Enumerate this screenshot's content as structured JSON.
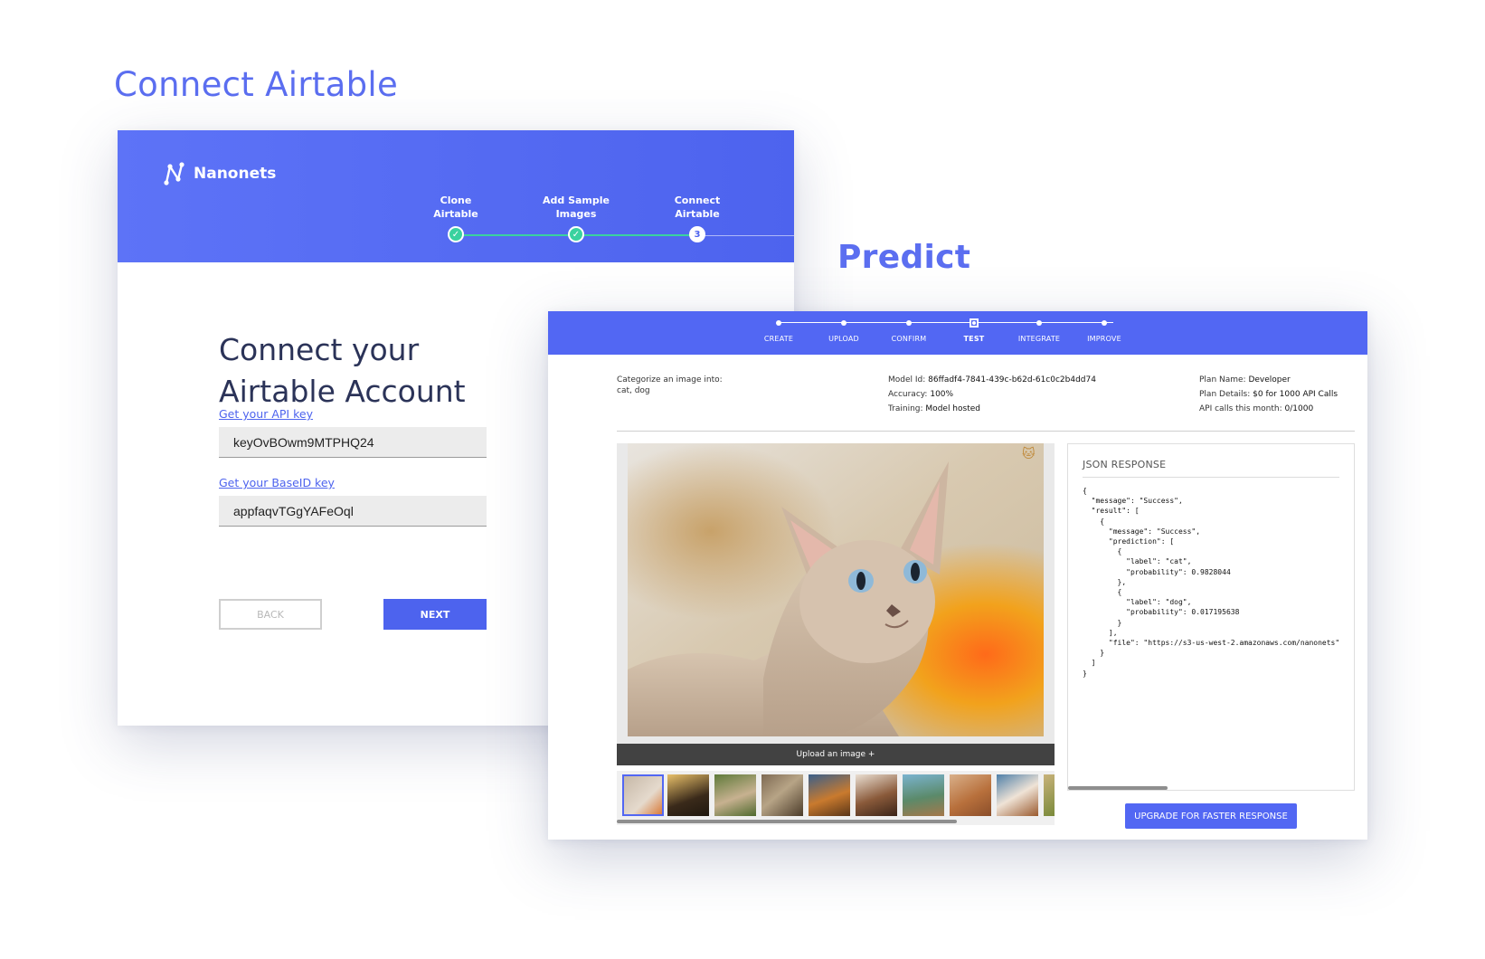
{
  "headings": {
    "connect": "Connect Airtable",
    "predict": "Predict"
  },
  "connect": {
    "brand": "Nanonets",
    "steps": [
      {
        "line1": "Clone",
        "line2": "Airtable",
        "state": "done"
      },
      {
        "line1": "Add Sample",
        "line2": "Images",
        "state": "done"
      },
      {
        "line1": "Connect",
        "line2": "Airtable",
        "state": "current",
        "number": "3"
      }
    ],
    "title_line1": "Connect your",
    "title_line2": "Airtable Account",
    "api_link": "Get your API key",
    "api_value": "keyOvBOwm9MTPHQ24",
    "base_link": "Get your BaseID key",
    "base_value": "appfaqvTGgYAFeOql",
    "back_label": "BACK",
    "next_label": "NEXT",
    "colors": {
      "header": "#4d63ee",
      "done": "#3ad29f",
      "title": "#2b3358"
    }
  },
  "predict": {
    "steps": [
      "CREATE",
      "UPLOAD",
      "CONFIRM",
      "TEST",
      "INTEGRATE",
      "IMPROVE"
    ],
    "current_step": "TEST",
    "categorize_label": "Categorize an image into:",
    "categories": "cat, dog",
    "model_id_label": "Model Id:",
    "model_id": "86ffadf4-7841-439c-b62d-61c0c2b4dd74",
    "accuracy_label": "Accuracy:",
    "accuracy": "100%",
    "training_label": "Training:",
    "training": "Model hosted",
    "plan_name_label": "Plan Name:",
    "plan_name": "Developer",
    "plan_details_label": "Plan Details:",
    "plan_details": "$0 for 1000 API Calls",
    "api_calls_label": "API calls this month:",
    "api_calls": "0/1000",
    "upload_label": "Upload an image +",
    "json_title": "JSON RESPONSE",
    "json_text": "{\n  \"message\": \"Success\",\n  \"result\": [\n    {\n      \"message\": \"Success\",\n      \"prediction\": [\n        {\n          \"label\": \"cat\",\n          \"probability\": 0.9828044\n        },\n        {\n          \"label\": \"dog\",\n          \"probability\": 0.017195638\n        }\n      ],\n      \"file\": \"https://s3-us-west-2.amazonaws.com/nanonets\"\n    }\n  ]\n}",
    "upgrade_label": "UPGRADE FOR FASTER RESPONSE",
    "thumbnails": [
      "sphynx-cat",
      "dog-on-grass",
      "pug",
      "tabby-cat",
      "abyssinian-cat",
      "cat-and-dog",
      "dog-by-lake",
      "cat-and-dog-lying",
      "beagle-puppy",
      "partial-thumb"
    ],
    "colors": {
      "header": "#5267f3"
    }
  }
}
